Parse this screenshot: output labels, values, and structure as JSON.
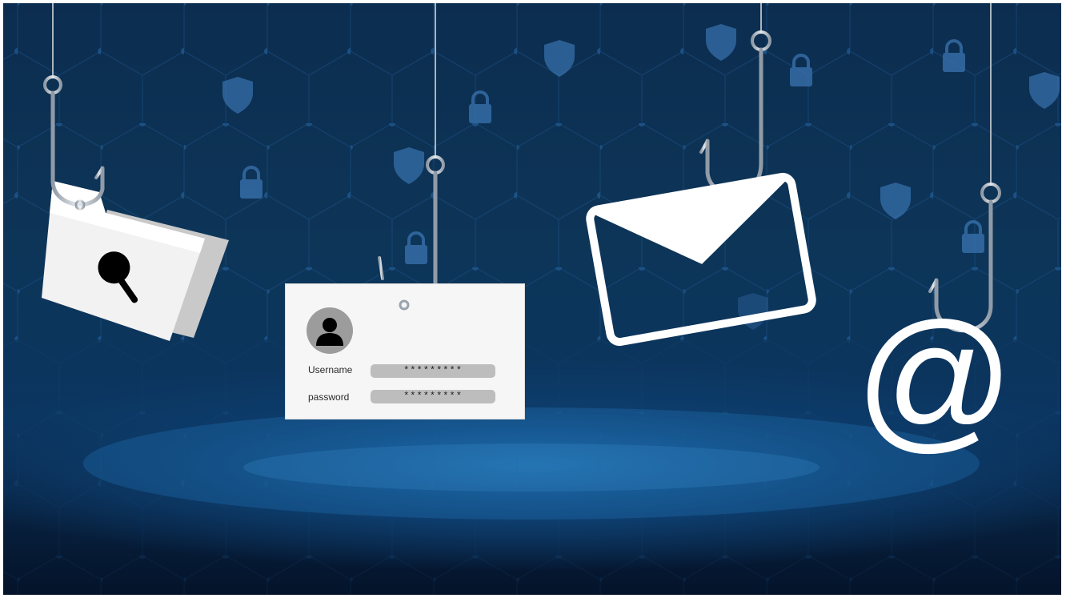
{
  "scene": {
    "background": {
      "top_color": "#0c2d4f",
      "glow_color": "#1d6aa6",
      "bottom_color": "#04132a",
      "pattern_color": "#1c4f82"
    },
    "icons": [
      {
        "name": "folder-search-icon"
      },
      {
        "name": "login-card"
      },
      {
        "name": "envelope-icon"
      },
      {
        "name": "at-sign-icon"
      },
      {
        "name": "fishing-hook-icon"
      },
      {
        "name": "padlock-icon"
      },
      {
        "name": "shield-icon"
      }
    ]
  },
  "login_card": {
    "username_label": "Username",
    "username_value": "*********",
    "password_label": "password",
    "password_value": "*********"
  },
  "at_sign": {
    "glyph": "@"
  }
}
